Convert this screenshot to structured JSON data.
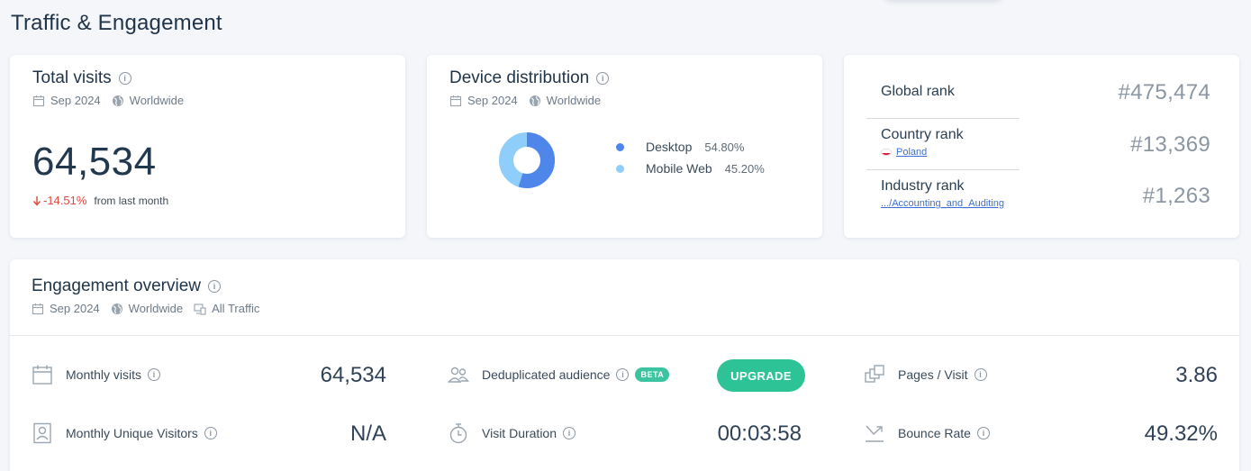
{
  "page": {
    "title": "Traffic & Engagement"
  },
  "colors": {
    "desktop": "#4f86ea",
    "mobile": "#8fcdfb",
    "negative": "#e2483d",
    "upgrade": "#2ec397"
  },
  "total_visits": {
    "title": "Total visits",
    "date": "Sep 2024",
    "region": "Worldwide",
    "value": "64,534",
    "change": "-14.51%",
    "change_suffix": "from last month"
  },
  "device_distribution": {
    "title": "Device distribution",
    "date": "Sep 2024",
    "region": "Worldwide",
    "items": [
      {
        "label": "Desktop",
        "percent": "54.80%",
        "value": 54.8
      },
      {
        "label": "Mobile Web",
        "percent": "45.20%",
        "value": 45.2
      }
    ]
  },
  "ranks": {
    "global": {
      "label": "Global rank",
      "value": "#475,474"
    },
    "country": {
      "label": "Country rank",
      "sub": "Poland",
      "value": "#13,369"
    },
    "industry": {
      "label": "Industry rank",
      "sub": ".../Accounting_and_Auditing",
      "value": "#1,263"
    }
  },
  "engagement": {
    "title": "Engagement overview",
    "date": "Sep 2024",
    "region": "Worldwide",
    "traffic": "All Traffic",
    "monthly_visits": {
      "label": "Monthly visits",
      "value": "64,534"
    },
    "unique_visitors": {
      "label": "Monthly Unique Visitors",
      "value": "N/A"
    },
    "dedup_audience": {
      "label": "Deduplicated audience",
      "badge": "BETA",
      "button": "UPGRADE"
    },
    "visit_duration": {
      "label": "Visit Duration",
      "value": "00:03:58"
    },
    "pages_per_visit": {
      "label": "Pages / Visit",
      "value": "3.86"
    },
    "bounce_rate": {
      "label": "Bounce Rate",
      "value": "49.32%"
    }
  }
}
